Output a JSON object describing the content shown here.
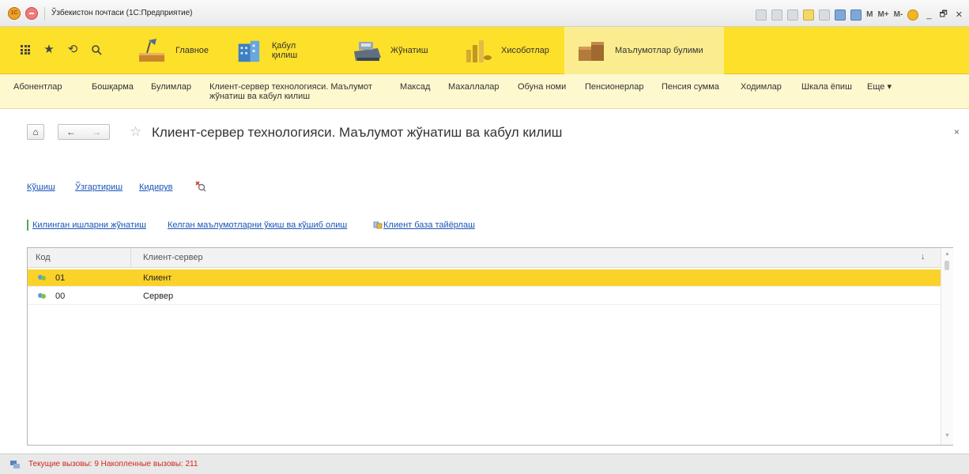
{
  "window": {
    "title": "Ўзбекистон почтаси (1С:Предприятие)",
    "controls": {
      "m": "M",
      "mplus": "M+",
      "mminus": "M-",
      "min": "_",
      "restore": "🗗",
      "close": "✕"
    }
  },
  "sections": {
    "items": [
      {
        "label": "Главное"
      },
      {
        "label": "Қабул қилиш"
      },
      {
        "label": "Жўнатиш"
      },
      {
        "label": "Хисоботлар"
      },
      {
        "label": "Маълумотлар булими",
        "active": true
      }
    ]
  },
  "subsections": {
    "items": [
      "Абонентлар",
      "Бошқарма",
      "Булимлар",
      "Клиент-сервер технологияси. Маълумот",
      "жўнатиш ва кабул килиш",
      "Максад",
      "Махаллалар",
      "Обуна номи",
      "Пенсионерлар",
      "Пенсия сумма",
      "Ходимлар",
      "Шкала ёпиш",
      "Еще ▾"
    ]
  },
  "page": {
    "title": "Клиент-сервер технологияси. Маълумот жўнатиш ва кабул килиш",
    "home_glyph": "⌂",
    "back_glyph": "←",
    "forward_glyph": "→",
    "star_glyph": "☆",
    "close_glyph": "×"
  },
  "commands": {
    "add": "Кўшиш",
    "change": "Ўзгартириш",
    "search": "Кидирув"
  },
  "links": {
    "send": "Килинган ишларни жўнатиш",
    "receive": "Келган маълумотларни ўкиш ва кўшиб олиш",
    "prepare": "Клиент база тайёрлаш"
  },
  "table": {
    "columns": [
      "Код",
      "Клиент-сервер"
    ],
    "sort_glyph": "↓",
    "rows": [
      {
        "code": "01",
        "name": "Клиент",
        "selected": true
      },
      {
        "code": "00",
        "name": "Сервер",
        "selected": false
      }
    ]
  },
  "status": {
    "text": "Текущие вызовы: 9   Накопленные вызовы: 211"
  }
}
